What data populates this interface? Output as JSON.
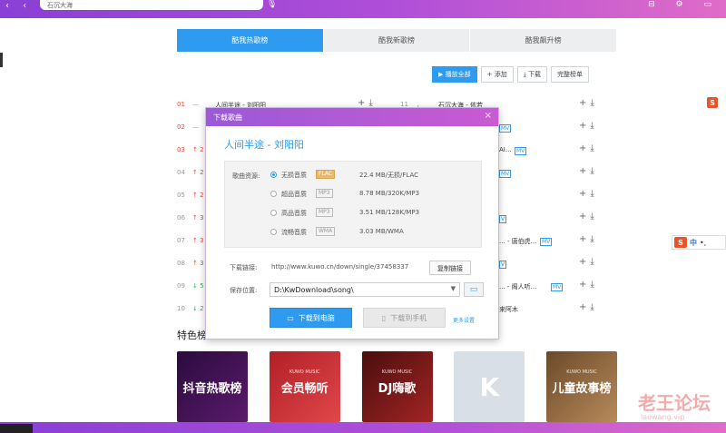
{
  "topbar": {
    "search_value": "石沉大海"
  },
  "tabs": [
    {
      "label": "酷我热歌榜",
      "active": true
    },
    {
      "label": "酷我新歌榜",
      "active": false
    },
    {
      "label": "酷我飙升榜",
      "active": false
    }
  ],
  "actions": {
    "play_all": "播放全部",
    "add": "添加",
    "download": "下载",
    "full_list": "完整榜单"
  },
  "songs": [
    {
      "rank": "01",
      "trend": "—",
      "title": "人间半途 - 刘阳阳",
      "rank2": "11",
      "trend2": "↓ 8",
      "title2": "石沉大海 - 依若",
      "mv2": ""
    },
    {
      "rank": "02",
      "trend": "—",
      "title": "",
      "rank2": "",
      "trend2": "",
      "title2": "",
      "mv2": "MV"
    },
    {
      "rank": "03",
      "trend": "↑ 2",
      "title": "",
      "rank2": "",
      "trend2": "",
      "title2": "AI...",
      "mv2": "MV"
    },
    {
      "rank": "04",
      "trend": "↑ 2",
      "title": "",
      "rank2": "",
      "trend2": "",
      "title2": "",
      "mv2": "MV"
    },
    {
      "rank": "05",
      "trend": "↑ 2",
      "title": "",
      "rank2": "",
      "trend2": "",
      "title2": "",
      "mv2": ""
    },
    {
      "rank": "06",
      "trend": "↑ 3",
      "title": "",
      "rank2": "",
      "trend2": "",
      "title2": "",
      "mv2": "V"
    },
    {
      "rank": "07",
      "trend": "↑ 3",
      "title": "",
      "rank2": "",
      "trend2": "",
      "title2": "... - 唐伯虎...",
      "mv2": "MV"
    },
    {
      "rank": "08",
      "trend": "↑ 3",
      "title": "",
      "rank2": "",
      "trend2": "",
      "title2": "",
      "mv2": "V"
    },
    {
      "rank": "09",
      "trend": "↓ 5",
      "title": "",
      "rank2": "",
      "trend2": "",
      "title2": "... - 阁人听...",
      "mv2": "MV"
    },
    {
      "rank": "10",
      "trend": "↓ 2",
      "title": "",
      "rank2": "",
      "trend2": "",
      "title2": "来阿木",
      "mv2": ""
    }
  ],
  "special": {
    "title": "特色榜",
    "covers": [
      {
        "label": "抖音热歌榜",
        "sub": ""
      },
      {
        "label": "会员畅听",
        "sub": "KUWO MUSIC"
      },
      {
        "label": "DJ嗨歌",
        "sub": "KUWO MUSIC"
      },
      {
        "label": "",
        "sub": ""
      },
      {
        "label": "儿童故事榜",
        "sub": "KUWO MUSIC"
      }
    ]
  },
  "dialog": {
    "title": "下载歌曲",
    "close": "×",
    "song": "人间半途 - 刘阳阳",
    "quality_label": "歌曲资源:",
    "qualities": [
      {
        "name": "无损音质",
        "tag": "FLAC",
        "info": "22.4 MB/无损/FLAC",
        "selected": true
      },
      {
        "name": "超品音质",
        "tag": "MP3",
        "info": "8.78 MB/320K/MP3",
        "selected": false
      },
      {
        "name": "高品音质",
        "tag": "MP3",
        "info": "3.51 MB/128K/MP3",
        "selected": false
      },
      {
        "name": "流畅音质",
        "tag": "WMA",
        "info": "3.03 MB/WMA",
        "selected": false
      }
    ],
    "link_label": "下载链接:",
    "link_url": "http://www.kuwo.cn/down/single/37458337",
    "copy_label": "复制链接",
    "path_label": "保存位置:",
    "path_value": "D:\\KwDownload\\song\\",
    "download_pc": "下载到电脑",
    "download_phone": "下载到手机",
    "more_settings": "更多设置"
  },
  "ime": {
    "badge": "S",
    "zh": "中"
  },
  "watermark": {
    "text": "老王论坛",
    "sub": "laowang.vip"
  },
  "colors": {
    "accent": "#2f9bf0",
    "topbar_start": "#8a3fd6",
    "topbar_end": "#e06cc8",
    "rank_hot": "#e84b3c",
    "trend_down": "#27ae60"
  }
}
